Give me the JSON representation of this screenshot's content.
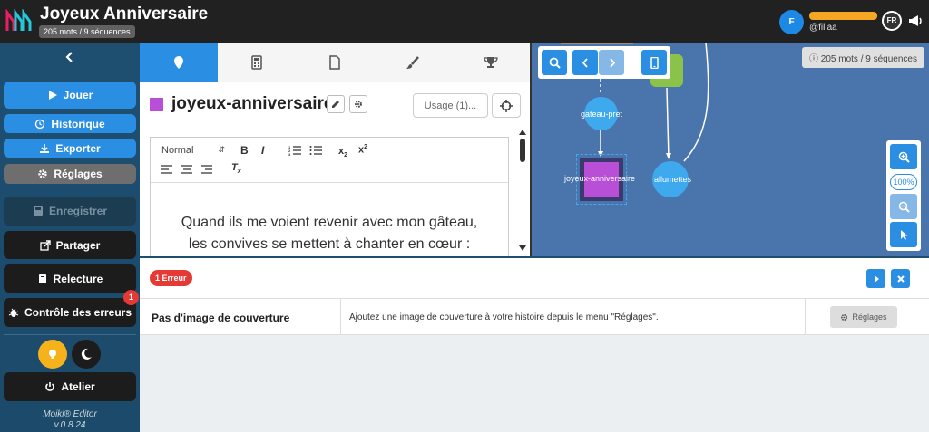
{
  "header": {
    "title": "Joyeux Anniversaire",
    "wordcount": "205 mots / 9 séquences",
    "user_initial": "F",
    "username": "@filiaa",
    "lang": "FR"
  },
  "sidebar": {
    "jouer": "Jouer",
    "historique": "Historique",
    "exporter": "Exporter",
    "reglages": "Réglages",
    "enregistrer": "Enregistrer",
    "partager": "Partager",
    "relecture": "Relecture",
    "controle": "Contrôle des erreurs",
    "error_count": "1",
    "atelier": "Atelier",
    "app_name": "Moiki® Editor",
    "version": "v.0.8.24"
  },
  "editor": {
    "sequence_title": "joyeux-anniversaire",
    "sequence_color": "#b84fd6",
    "usage_label": "Usage (1)...",
    "font_label": "Normal",
    "bold_label": "B",
    "italic_label": "I",
    "content_line1": "Quand ils me voient revenir avec mon gâteau,",
    "content_line2": "les convives se mettent à chanter en cœur :"
  },
  "map": {
    "wordcount": "205 mots / 9 séquences",
    "node_gateau": "gateau-pret",
    "node_joyeux": "joyeux-anniversaire",
    "node_allumettes": "allumettes",
    "zoom_level": "100%"
  },
  "errors": {
    "badge": "1 Erreur",
    "title": "Pas d'image de couverture",
    "description": "Ajoutez une image de couverture à votre histoire depuis le menu \"Réglages\".",
    "fix_button": "Réglages"
  },
  "colors": {
    "accent": "#2a8ee3",
    "sidebar_bg": "#1e4f71",
    "error": "#e53935",
    "map_bg": "#4a74ac"
  }
}
